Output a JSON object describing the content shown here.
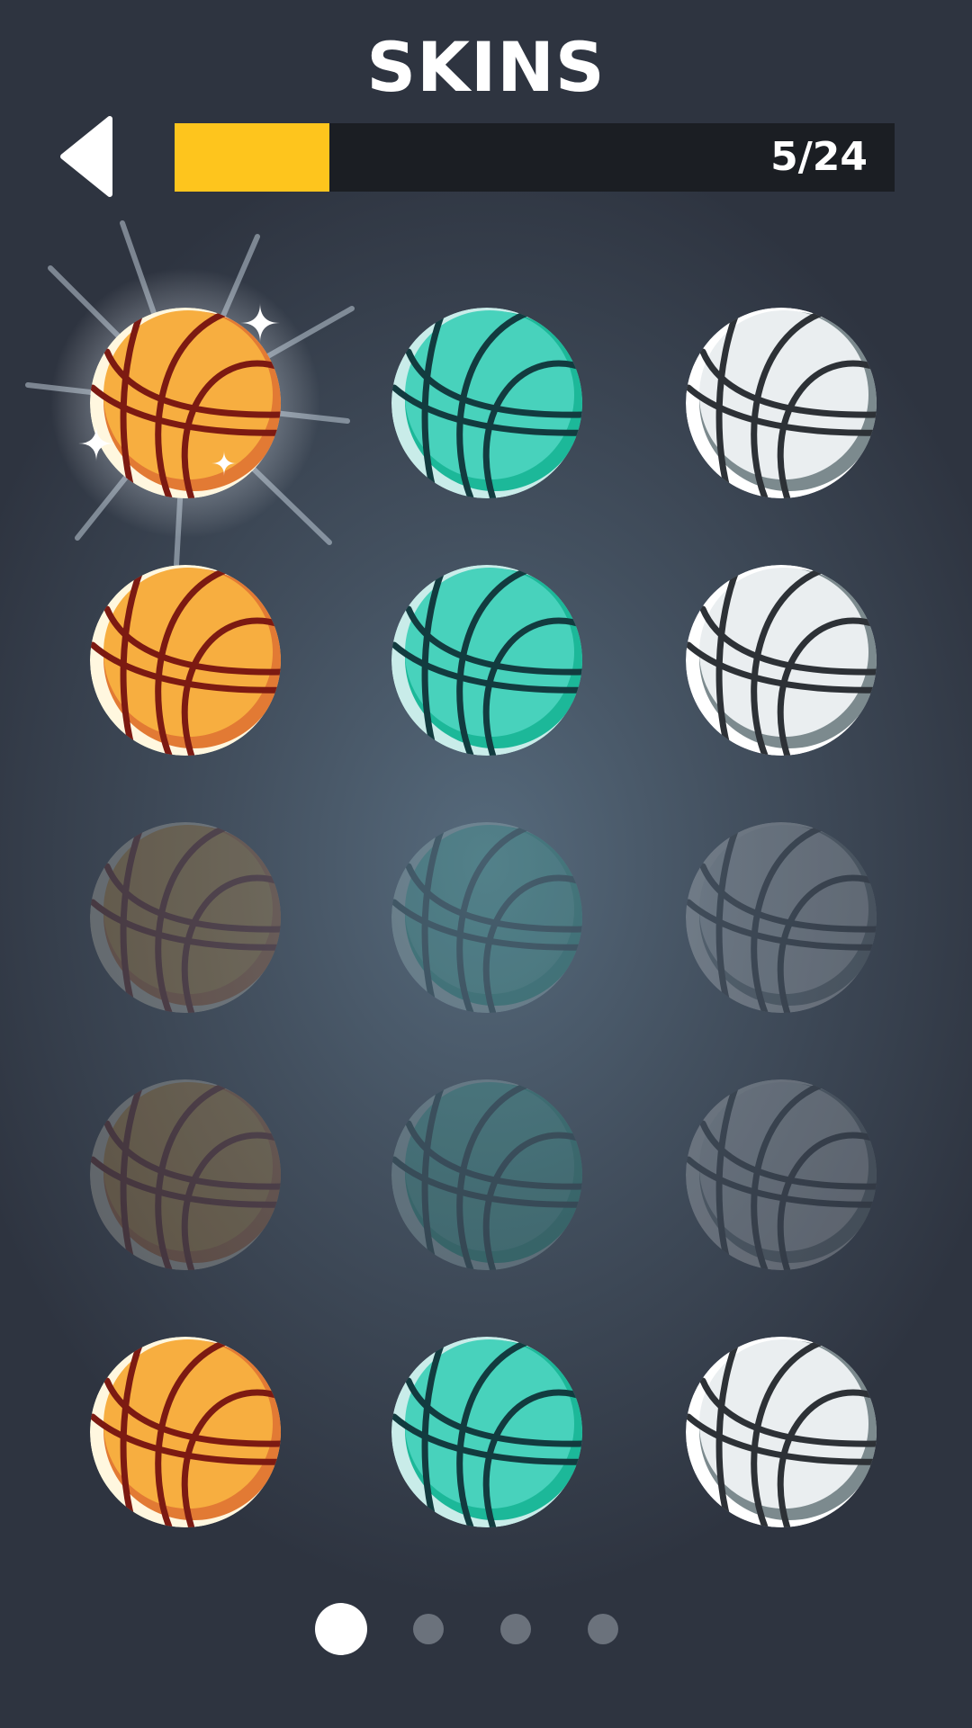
{
  "header": {
    "title": "SKINS",
    "back_icon": "back-arrow-icon"
  },
  "progress": {
    "label": "5/24",
    "unlocked": 5,
    "total": 24,
    "fill_fraction": 0.215,
    "fill_color": "#fec51d",
    "track_color": "#1b1e23"
  },
  "palettes": {
    "orange": {
      "base": "#f7ae40",
      "shade": "#e27a34",
      "highlight": "#fff7df",
      "seam": "#7c1a12"
    },
    "teal": {
      "base": "#48d2bc",
      "shade": "#1cb899",
      "highlight": "#c9ece9",
      "seam": "#123b3f"
    },
    "white": {
      "base": "#eaeef0",
      "shade": "#7c8a8e",
      "highlight": "#ffffff",
      "seam": "#2d3136"
    }
  },
  "skins": [
    {
      "id": "orange-1",
      "color": "orange",
      "state": "selected"
    },
    {
      "id": "teal-1",
      "color": "teal",
      "state": "unlocked"
    },
    {
      "id": "white-1",
      "color": "white",
      "state": "unlocked"
    },
    {
      "id": "orange-2",
      "color": "orange",
      "state": "unlocked"
    },
    {
      "id": "teal-2",
      "color": "teal",
      "state": "unlocked"
    },
    {
      "id": "white-2",
      "color": "white",
      "state": "unlocked"
    },
    {
      "id": "orange-3",
      "color": "orange",
      "state": "locked"
    },
    {
      "id": "teal-3",
      "color": "teal",
      "state": "locked"
    },
    {
      "id": "white-3",
      "color": "white",
      "state": "locked"
    },
    {
      "id": "orange-4",
      "color": "orange",
      "state": "locked"
    },
    {
      "id": "teal-4",
      "color": "teal",
      "state": "locked"
    },
    {
      "id": "white-4",
      "color": "white",
      "state": "locked"
    },
    {
      "id": "orange-5",
      "color": "orange",
      "state": "unlocked"
    },
    {
      "id": "teal-5",
      "color": "teal",
      "state": "unlocked"
    },
    {
      "id": "white-5",
      "color": "white",
      "state": "unlocked"
    }
  ],
  "pager": {
    "pages": 4,
    "current": 1,
    "active_color": "#ffffff",
    "inactive_color": "#6b727c"
  }
}
